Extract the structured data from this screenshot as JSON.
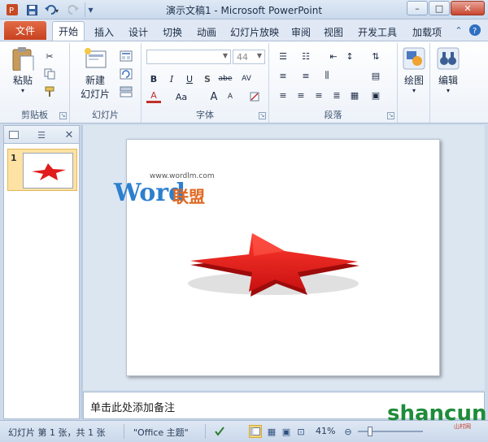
{
  "window": {
    "title": "演示文稿1 - Microsoft PowerPoint",
    "minimize_glyph": "–",
    "maximize_glyph": "□",
    "close_glyph": "✕"
  },
  "quick_access": {
    "save_icon": "save-icon",
    "undo_icon": "undo-icon",
    "redo_icon": "redo-icon",
    "customize_glyph": "▾"
  },
  "tabs": {
    "file": "文件",
    "items": [
      "开始",
      "插入",
      "设计",
      "切换",
      "动画",
      "幻灯片放映",
      "审阅",
      "视图",
      "开发工具",
      "加载项"
    ],
    "active_index": 0
  },
  "ribbon": {
    "clipboard": {
      "paste": "粘贴",
      "label": "剪贴板"
    },
    "slides": {
      "new_slide_line1": "新建",
      "new_slide_line2": "幻灯片",
      "label": "幻灯片"
    },
    "font": {
      "font_name": "",
      "font_size": "44",
      "bold": "B",
      "italic": "I",
      "underline": "U",
      "shadow": "S",
      "strike": "abe",
      "spacing": "AV",
      "font_color": "A",
      "case": "Aa",
      "grow": "A",
      "shrink": "A",
      "label": "字体"
    },
    "paragraph": {
      "label": "段落"
    },
    "drawing": {
      "label": "绘图"
    },
    "editing": {
      "label": "编辑"
    }
  },
  "slide_panel": {
    "thumb_number": "1"
  },
  "watermark": {
    "url": "www.wordlm.com",
    "word": "Word",
    "lm": "联盟"
  },
  "notes": {
    "placeholder": "单击此处添加备注"
  },
  "statusbar": {
    "slide_info": "幻灯片 第 1 张，共 1 张",
    "theme": "\"Office 主题\"",
    "zoom": "41%"
  },
  "brand": {
    "shancun_main": "shancun",
    "shancun_sub": "山村网"
  },
  "colors": {
    "file_tab": "#d4512b",
    "star": "#e11b1b",
    "accent": "#2b579a"
  }
}
